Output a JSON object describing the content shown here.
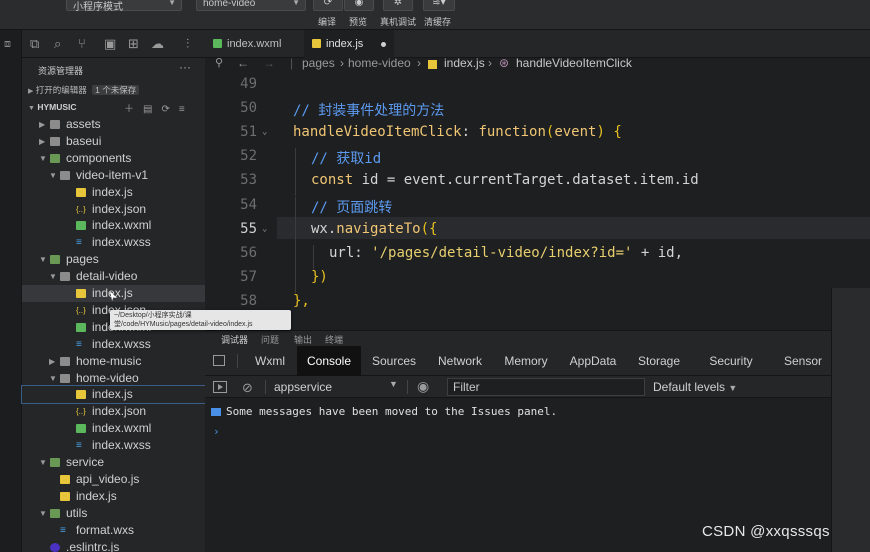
{
  "toolbar": {
    "mode_select": "小程序模式",
    "page_select": "home-video",
    "buttons": [
      {
        "label": "编译",
        "icon": "refresh-icon"
      },
      {
        "label": "预览",
        "icon": "eye-icon"
      },
      {
        "label": "真机调试",
        "icon": "bug-icon"
      },
      {
        "label": "清缓存",
        "icon": "layers-icon"
      }
    ]
  },
  "sidebar": {
    "title": "资源管理器",
    "more": "···",
    "open_editors_label": "打开的编辑器",
    "open_editors_badge": "1 个未保存",
    "project": "HYMUSIC",
    "tree": [
      {
        "label": "assets",
        "type": "folder",
        "depth": 0,
        "open": false
      },
      {
        "label": "baseui",
        "type": "folder",
        "depth": 0,
        "open": false
      },
      {
        "label": "components",
        "type": "folder-green",
        "depth": 0,
        "open": true
      },
      {
        "label": "video-item-v1",
        "type": "folder",
        "depth": 1,
        "open": true
      },
      {
        "label": "index.js",
        "type": "js",
        "depth": 2
      },
      {
        "label": "index.json",
        "type": "json",
        "depth": 2
      },
      {
        "label": "index.wxml",
        "type": "wxml",
        "depth": 2
      },
      {
        "label": "index.wxss",
        "type": "wxss",
        "depth": 2
      },
      {
        "label": "pages",
        "type": "folder-green",
        "depth": 0,
        "open": true
      },
      {
        "label": "detail-video",
        "type": "folder",
        "depth": 1,
        "open": true
      },
      {
        "label": "index.js",
        "type": "js",
        "depth": 2,
        "hover": true
      },
      {
        "label": "index.json",
        "type": "json",
        "depth": 2
      },
      {
        "label": "index.wxml",
        "type": "wxml",
        "depth": 2
      },
      {
        "label": "index.wxss",
        "type": "wxss",
        "depth": 2
      },
      {
        "label": "home-music",
        "type": "folder",
        "depth": 1,
        "open": false
      },
      {
        "label": "home-video",
        "type": "folder",
        "depth": 1,
        "open": true
      },
      {
        "label": "index.js",
        "type": "js",
        "depth": 2,
        "selected": true
      },
      {
        "label": "index.json",
        "type": "json",
        "depth": 2
      },
      {
        "label": "index.wxml",
        "type": "wxml",
        "depth": 2
      },
      {
        "label": "index.wxss",
        "type": "wxss",
        "depth": 2
      },
      {
        "label": "service",
        "type": "folder-green",
        "depth": 0,
        "open": true
      },
      {
        "label": "api_video.js",
        "type": "js",
        "depth": 1
      },
      {
        "label": "index.js",
        "type": "js",
        "depth": 1
      },
      {
        "label": "utils",
        "type": "folder-green",
        "depth": 0,
        "open": true
      },
      {
        "label": "format.wxs",
        "type": "wxss",
        "depth": 1
      },
      {
        "label": ".eslintrc.js",
        "type": "eslint",
        "depth": 0
      }
    ],
    "tooltip": "~/Desktop/小程序实战/课堂/code/HYMusic/pages/detail-video/index.js"
  },
  "editor": {
    "tabs": [
      {
        "label": "index.wxml",
        "active": false
      },
      {
        "label": "index.js",
        "active": true,
        "unsaved": true
      }
    ],
    "breadcrumb": [
      "pages",
      "home-video",
      "index.js",
      "handleVideoItemClick"
    ],
    "current_line": 55,
    "lines": [
      {
        "n": 49,
        "indent": 0,
        "tokens": []
      },
      {
        "n": 50,
        "indent": 0,
        "tokens": [
          {
            "t": "// 封装事件处理的方法",
            "c": "com"
          }
        ]
      },
      {
        "n": 51,
        "indent": 0,
        "fold": true,
        "tokens": [
          {
            "t": "handleVideoItemClick",
            "c": "fn"
          },
          {
            "t": ": ",
            "c": "var"
          },
          {
            "t": "function",
            "c": "kw"
          },
          {
            "t": "(",
            "c": "punc"
          },
          {
            "t": "event",
            "c": "fn"
          },
          {
            "t": ") {",
            "c": "punc"
          }
        ]
      },
      {
        "n": 52,
        "indent": 1,
        "tokens": [
          {
            "t": "// 获取id",
            "c": "com"
          }
        ]
      },
      {
        "n": 53,
        "indent": 1,
        "tokens": [
          {
            "t": "const",
            "c": "kw"
          },
          {
            "t": " id = event.currentTarget.dataset.item.id",
            "c": "var"
          }
        ]
      },
      {
        "n": 54,
        "indent": 1,
        "tokens": [
          {
            "t": "// 页面跳转",
            "c": "com"
          }
        ]
      },
      {
        "n": 55,
        "indent": 1,
        "fold": true,
        "tokens": [
          {
            "t": "wx.",
            "c": "var"
          },
          {
            "t": "navigateTo",
            "c": "fn"
          },
          {
            "t": "({",
            "c": "punc"
          }
        ]
      },
      {
        "n": 56,
        "indent": 2,
        "tokens": [
          {
            "t": "url: ",
            "c": "var"
          },
          {
            "t": "'/pages/detail-video/index?id='",
            "c": "str"
          },
          {
            "t": " + id,",
            "c": "var"
          }
        ]
      },
      {
        "n": 57,
        "indent": 1,
        "tokens": [
          {
            "t": "})",
            "c": "punc"
          }
        ]
      },
      {
        "n": 58,
        "indent": 0,
        "tokens": [
          {
            "t": "},",
            "c": "punc"
          }
        ]
      }
    ]
  },
  "devtools": {
    "top_tabs": [
      "调试器",
      "问题",
      "输出",
      "终端"
    ],
    "panel_tabs": [
      "Wxml",
      "Console",
      "Sources",
      "Network",
      "Memory",
      "AppData",
      "Storage",
      "Security",
      "Sensor"
    ],
    "active_panel": "Console",
    "context": "appservice",
    "filter_placeholder": "Filter",
    "levels": "Default levels",
    "messages": [
      "Some messages have been moved to the Issues panel."
    ],
    "prompt": "›"
  },
  "watermark": "CSDN @xxqsssqs",
  "colors": {
    "background": "#1e1f21",
    "comment": "#5c9aef",
    "keyword": "#f0c674",
    "string": "#e7cf6e",
    "console_info": "#4a8fe7"
  }
}
